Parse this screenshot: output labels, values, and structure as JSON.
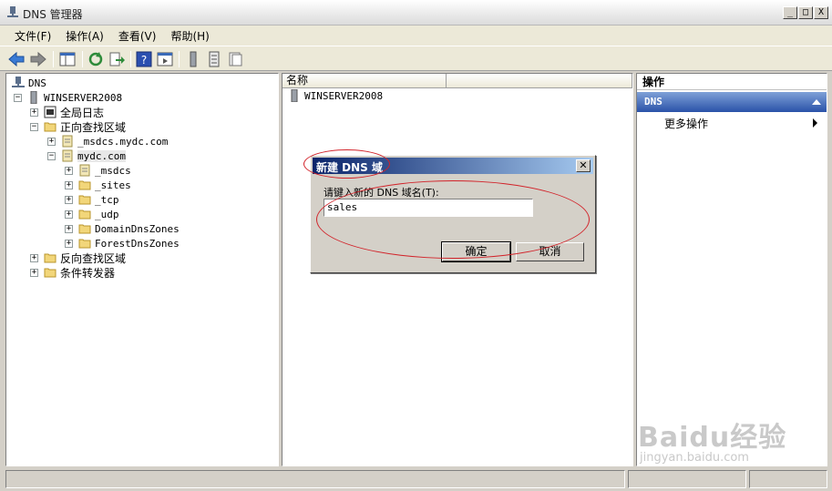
{
  "window": {
    "title": "DNS 管理器",
    "controls": [
      "_",
      "□",
      "X"
    ]
  },
  "menu": [
    {
      "label": "文件(F)"
    },
    {
      "label": "操作(A)"
    },
    {
      "label": "查看(V)"
    },
    {
      "label": "帮助(H)"
    }
  ],
  "toolbar": {
    "icons": [
      "back-icon",
      "forward-icon",
      "show-tree-icon",
      "refresh-icon",
      "export-icon",
      "help-icon",
      "details-icon",
      "server-icon",
      "list-icon",
      "properties-icon"
    ]
  },
  "tree": {
    "root": "DNS",
    "server": "WINSERVER2008",
    "global_logs": "全局日志",
    "forward_zones": "正向查找区域",
    "msdcs_zone": "_msdcs.mydc.com",
    "zone": "mydc.com",
    "children": [
      "_msdcs",
      "_sites",
      "_tcp",
      "_udp",
      "DomainDnsZones",
      "ForestDnsZones"
    ],
    "reverse_zones": "反向查找区域",
    "forwarders": "条件转发器"
  },
  "list": {
    "column_name": "名称",
    "rows": [
      "WINSERVER2008"
    ]
  },
  "actions": {
    "title": "操作",
    "group": "DNS",
    "more": "更多操作"
  },
  "dialog": {
    "title": "新建 DNS 域",
    "prompt": "请键入新的 DNS 域名(T):",
    "value": "sales",
    "ok": "确定",
    "cancel": "取消"
  },
  "watermark": {
    "brand": "Baidu经验",
    "url": "jingyan.baidu.com"
  },
  "colors": {
    "accent": "#2a52a8",
    "annotation": "#d2232a"
  }
}
